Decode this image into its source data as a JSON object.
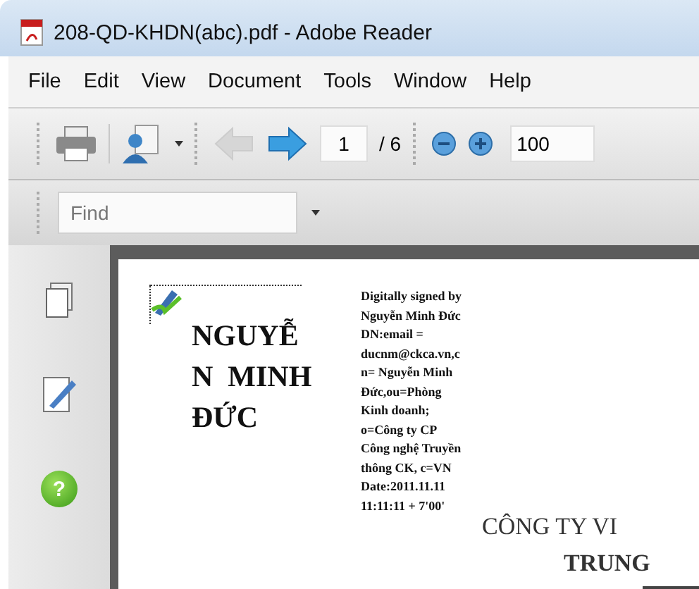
{
  "window": {
    "title": "208-QD-KHDN(abc).pdf - Adobe Reader"
  },
  "menu": [
    "File",
    "Edit",
    "View",
    "Document",
    "Tools",
    "Window",
    "Help"
  ],
  "toolbar": {
    "previous_page": {
      "disabled": true
    },
    "next_page": {
      "disabled": false
    },
    "page_number": "1",
    "page_total": "/ 6",
    "zoom": "100"
  },
  "find": {
    "placeholder": "Find"
  },
  "sidebar": [
    {
      "kind": "pages"
    },
    {
      "kind": "signatures"
    },
    {
      "kind": "help",
      "label": "?"
    }
  ],
  "document": {
    "signature_name": [
      "NGUYỄ",
      "N  MINH",
      "ĐỨC"
    ],
    "signature_details": [
      "Digitally signed by",
      "Nguyễn Minh Đức",
      "DN:email =",
      "ducnm@ckca.vn,c",
      "n= Nguyễn Minh",
      "Đức,ou=Phòng",
      "Kinh doanh;",
      "o=Công ty CP",
      "Công nghệ Truyền",
      "thông CK, c=VN",
      "Date:2011.11.11",
      "11:11:11 + 7'00'"
    ],
    "heading": [
      "CÔNG TY VI",
      "TRUNG"
    ]
  }
}
